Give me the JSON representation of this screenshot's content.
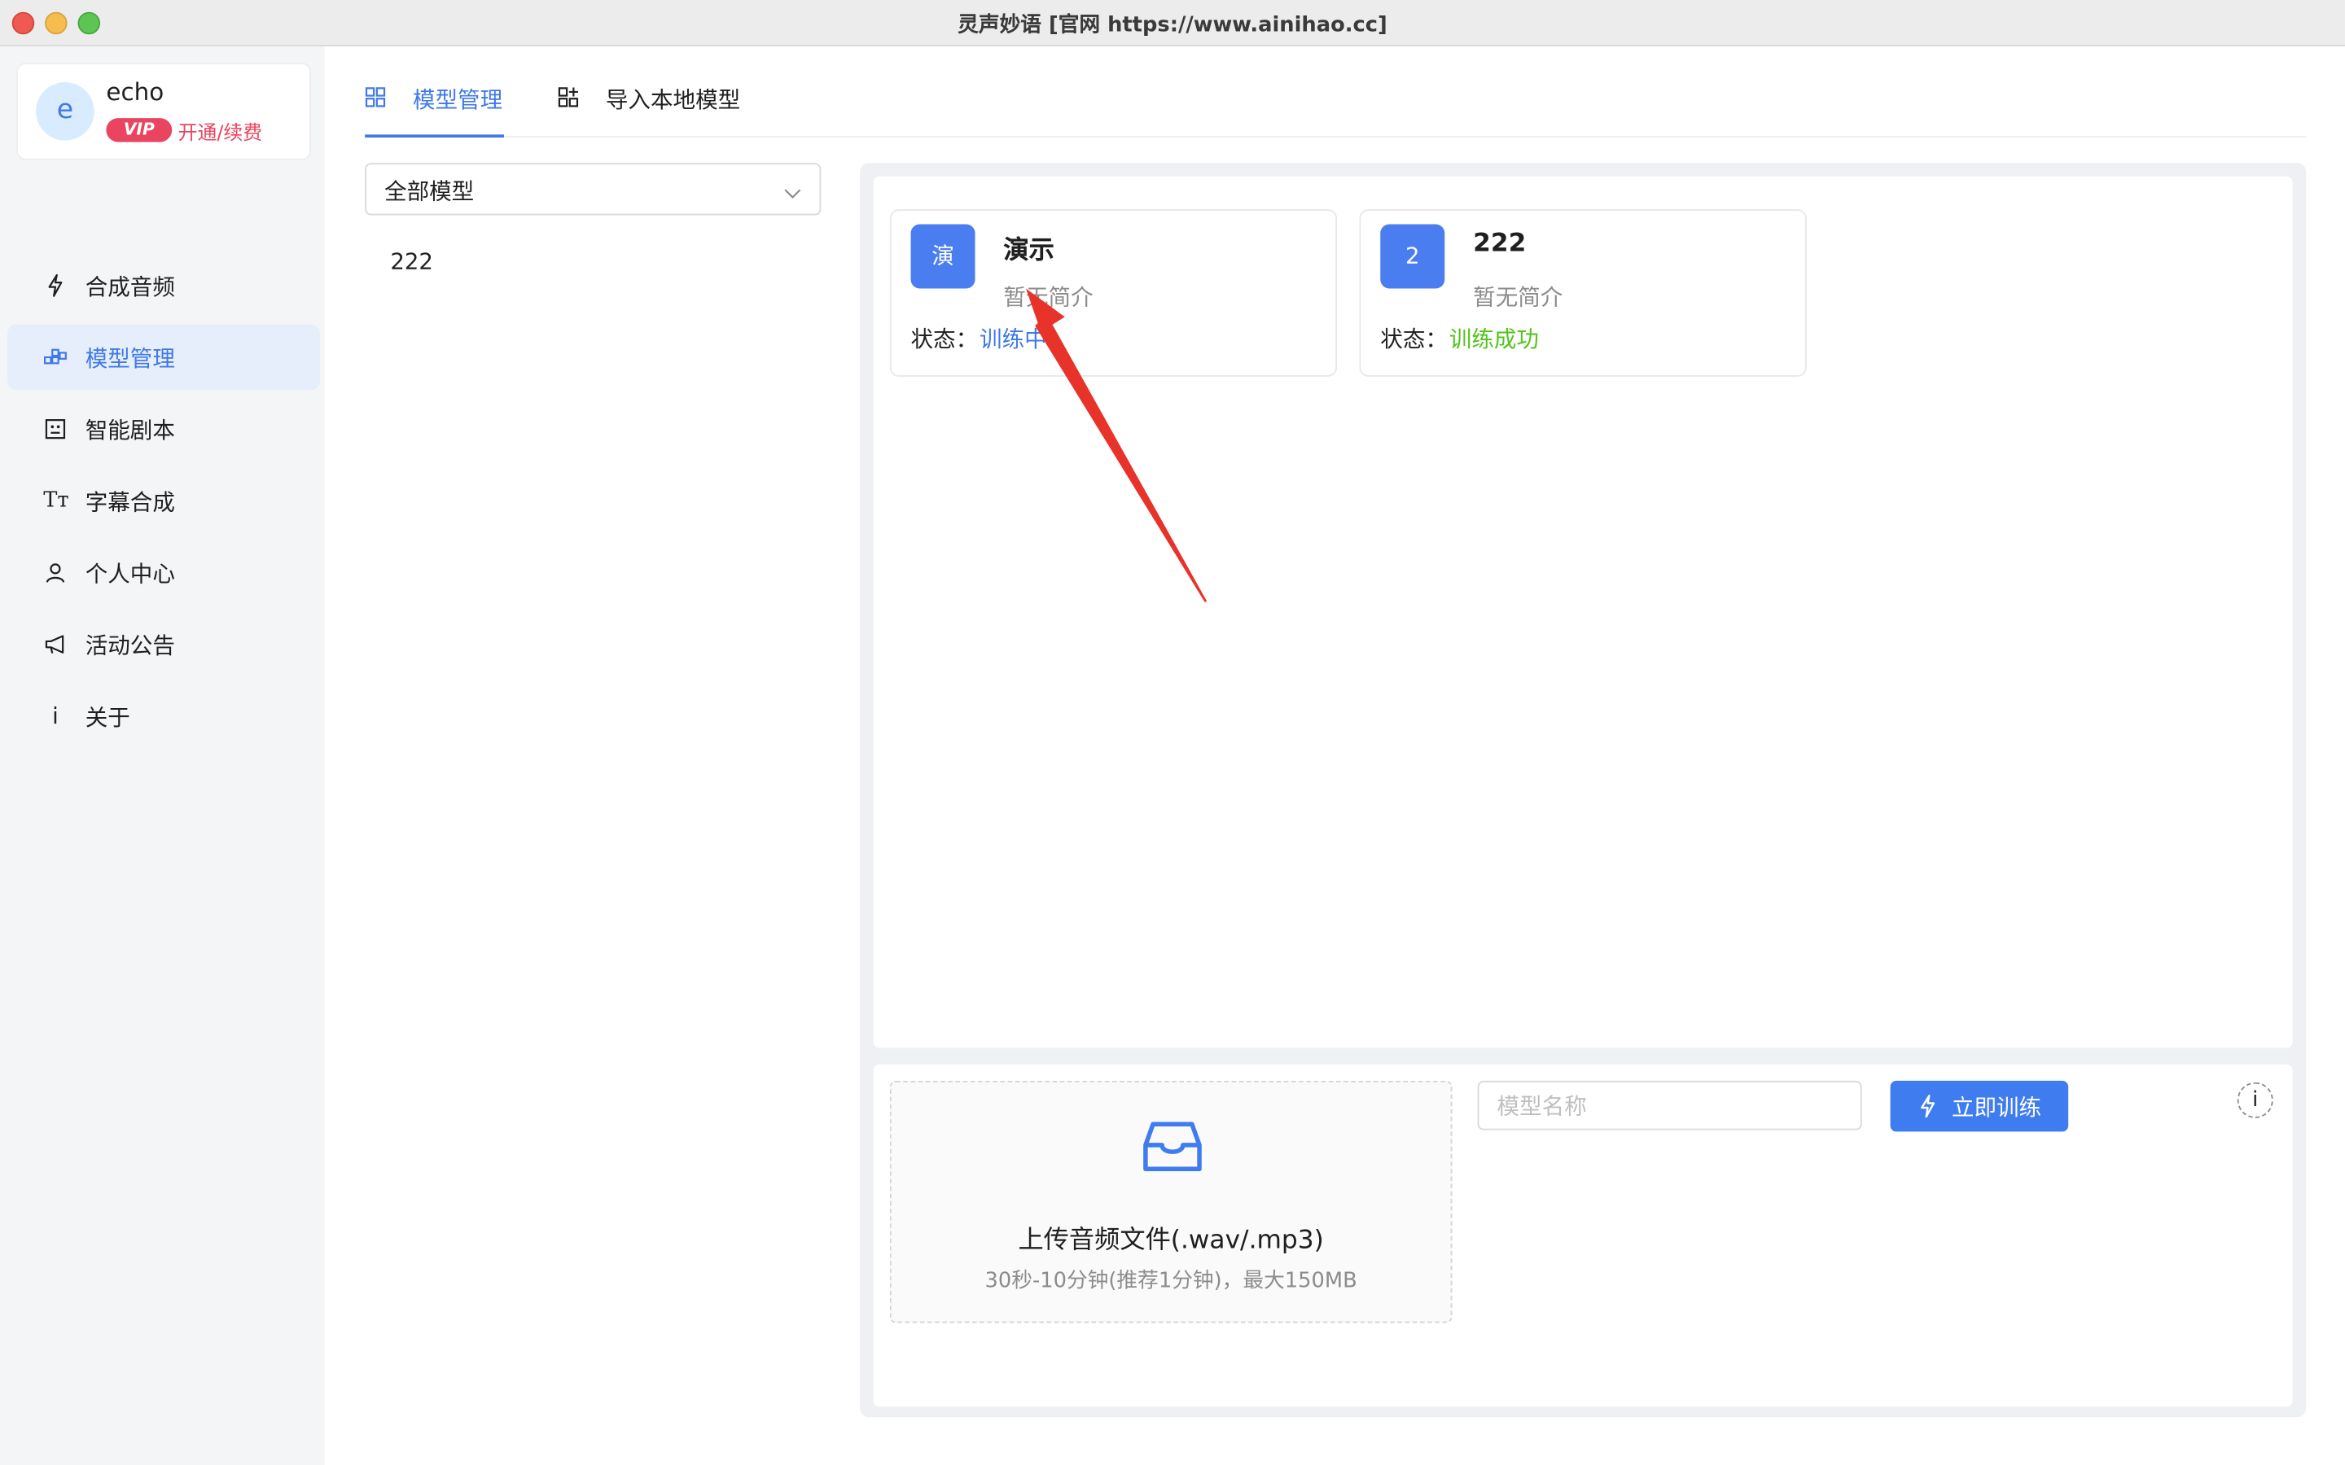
{
  "window": {
    "title": "灵声妙语 [官网 https://www.ainihao.cc]"
  },
  "user": {
    "avatar_letter": "e",
    "name": "echo",
    "vip_badge": "VIP",
    "vip_link": "开通/续费"
  },
  "sidebar": {
    "items": [
      {
        "label": "合成音频",
        "icon": "lightning-icon",
        "active": false
      },
      {
        "label": "模型管理",
        "icon": "blocks-icon",
        "active": true
      },
      {
        "label": "智能剧本",
        "icon": "script-icon",
        "active": false
      },
      {
        "label": "字幕合成",
        "icon": "text-size-icon",
        "active": false
      },
      {
        "label": "个人中心",
        "icon": "user-icon",
        "active": false
      },
      {
        "label": "活动公告",
        "icon": "megaphone-icon",
        "active": false
      },
      {
        "label": "关于",
        "icon": "info-icon",
        "active": false
      }
    ]
  },
  "tabs": [
    {
      "label": "模型管理",
      "active": true
    },
    {
      "label": "导入本地模型",
      "active": false
    }
  ],
  "filter": {
    "selected": "全部模型"
  },
  "model_list": [
    "222"
  ],
  "models": [
    {
      "avatar": "演",
      "name": "演示",
      "desc": "暂无简介",
      "status_label": "状态：",
      "status": "训练中",
      "status_color": "#3f79e8"
    },
    {
      "avatar": "2",
      "name": "222",
      "desc": "暂无简介",
      "status_label": "状态：",
      "status": "训练成功",
      "status_color": "#52c41a"
    }
  ],
  "upload": {
    "title": "上传音频文件(.wav/.mp3)",
    "hint": "30秒-10分钟(推荐1分钟)，最大150MB"
  },
  "train_form": {
    "name_placeholder": "模型名称",
    "train_button": "立即训练",
    "info_glyph": "i"
  },
  "colors": {
    "accent": "#3f79e8",
    "vip": "#e94560",
    "success": "#52c41a",
    "annotation_arrow": "#e8332a"
  }
}
